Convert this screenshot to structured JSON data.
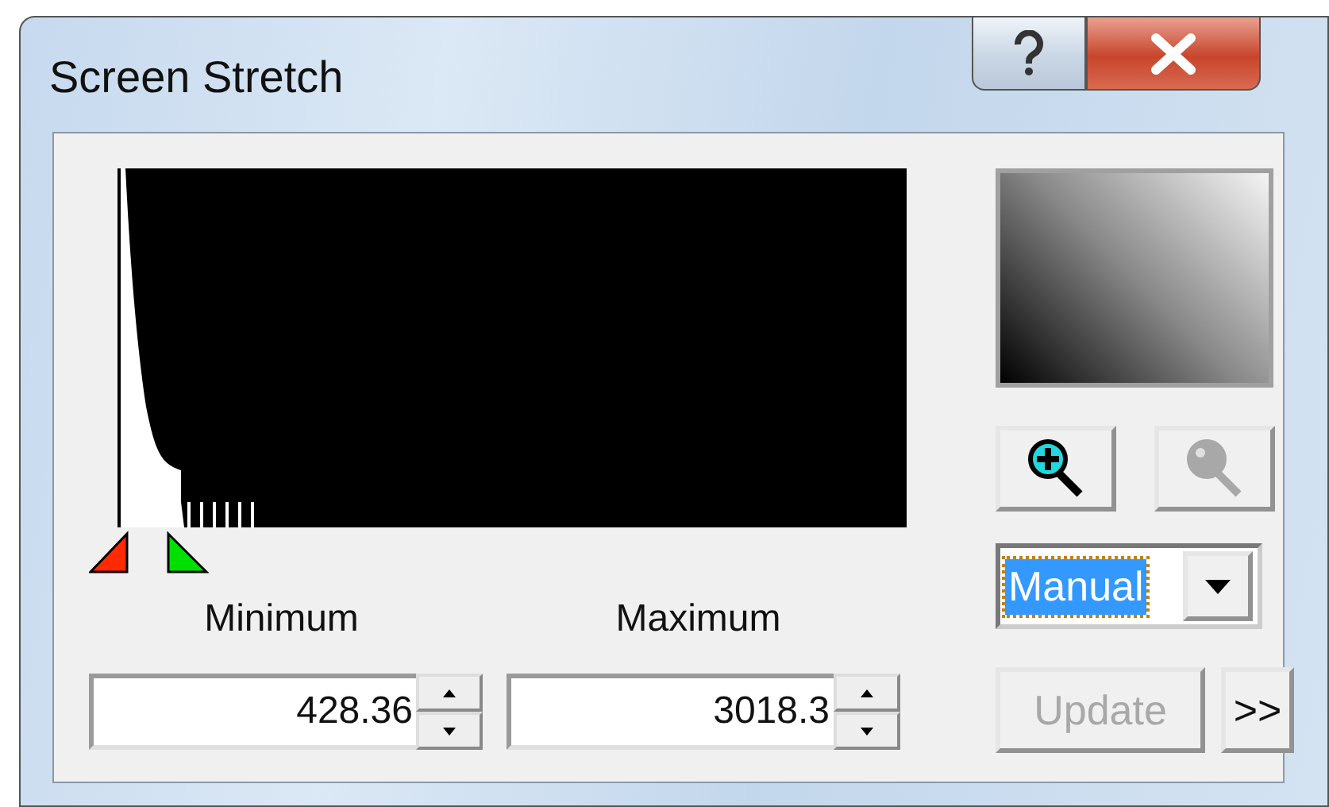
{
  "window": {
    "title": "Screen Stretch"
  },
  "title_buttons": [
    {
      "kind": "help"
    },
    {
      "kind": "close"
    }
  ],
  "limits": [
    {
      "label": "Minimum",
      "value": "428.36"
    },
    {
      "label": "Maximum",
      "value": "3018.3"
    }
  ],
  "zoom_buttons": [
    {
      "kind": "zoom_in",
      "disabled": false
    },
    {
      "kind": "zoom_out",
      "disabled": true
    }
  ],
  "mode": {
    "value": "Manual",
    "focused": true
  },
  "buttons": [
    {
      "label": "Update",
      "disabled": true
    },
    {
      "label": ">>",
      "disabled": false
    }
  ]
}
